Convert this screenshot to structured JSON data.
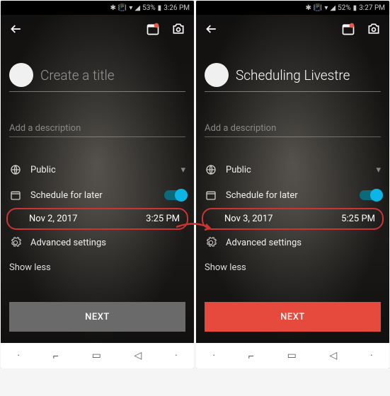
{
  "left": {
    "status": {
      "battery": "53%",
      "time": "3:26 PM"
    },
    "title": {
      "value": "",
      "placeholder": "Create a title"
    },
    "description_placeholder": "Add a description",
    "privacy_label": "Public",
    "schedule_label": "Schedule for later",
    "schedule_date": "Nov 2, 2017",
    "schedule_time": "3:25 PM",
    "advanced_label": "Advanced settings",
    "show_less": "Show less",
    "next": "NEXT"
  },
  "right": {
    "status": {
      "battery": "52%",
      "time": "3:27 PM"
    },
    "title": {
      "value": "Scheduling Livestre",
      "placeholder": "Create a title"
    },
    "description_placeholder": "Add a description",
    "privacy_label": "Public",
    "schedule_label": "Schedule for later",
    "schedule_date": "Nov 3, 2017",
    "schedule_time": "5:25 PM",
    "advanced_label": "Advanced settings",
    "show_less": "Show less",
    "next": "NEXT"
  }
}
